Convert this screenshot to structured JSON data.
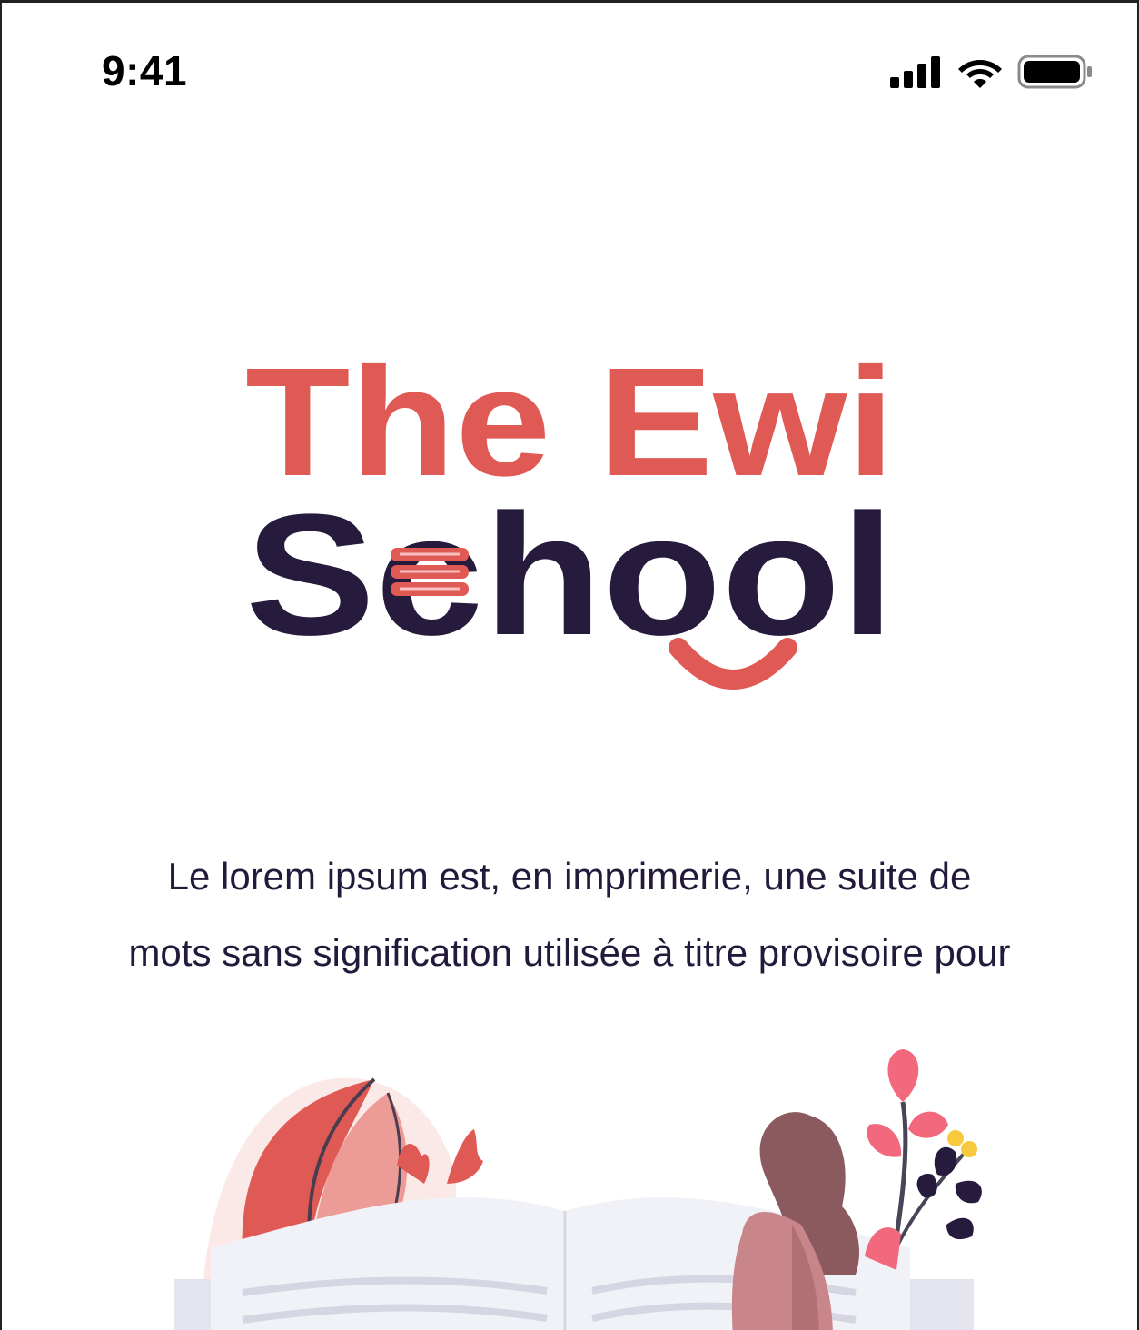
{
  "status_bar": {
    "time": "9:41",
    "icons": [
      "cellular-signal-icon",
      "wifi-icon",
      "battery-icon"
    ]
  },
  "logo": {
    "line1": "The Ewi",
    "line2": "School",
    "colors": {
      "accent": "#e05a55",
      "dark": "#261a3d",
      "book": "#f0a6a2"
    }
  },
  "description": {
    "line1": "Le lorem ipsum est, en imprimerie, une suite de",
    "line2": "mots sans signification utilisée à titre provisoire pour"
  },
  "colors": {
    "text": "#231a3b",
    "background": "#ffffff"
  }
}
